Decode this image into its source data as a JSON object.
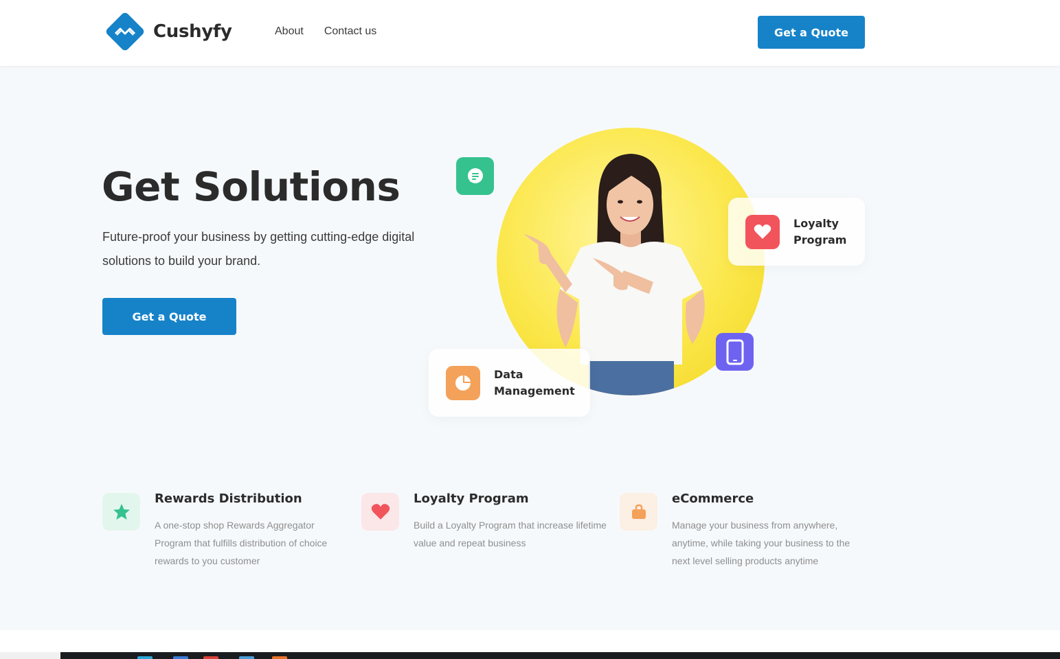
{
  "brand": {
    "name": "Cushyfy",
    "color": "#1683c9"
  },
  "nav": {
    "items": [
      "About",
      "Contact us"
    ]
  },
  "header": {
    "cta_label": "Get a Quote"
  },
  "hero": {
    "title": "Get Solutions",
    "subtitle": "Future-proof your business by getting cutting-edge digital solutions to build your brand.",
    "cta_label": "Get a Quote",
    "image": "smiling-woman-pointing",
    "floating_icons": [
      {
        "icon": "chat-icon",
        "color": "#35c28f"
      },
      {
        "icon": "phone-icon",
        "color": "#6e63f0"
      }
    ],
    "cards": [
      {
        "label_line1": "Loyalty",
        "label_line2": "Program",
        "icon": "heart-icon",
        "color": "#f2545b"
      },
      {
        "label_line1": "Data",
        "label_line2": "Management",
        "icon": "pie-chart-icon",
        "color": "#f4a15a"
      }
    ]
  },
  "features": [
    {
      "title": "Rewards Distribution",
      "description": "A one-stop shop Rewards Aggregator Program that fulfills distribution of choice rewards to you customer",
      "icon": "star-icon",
      "color": "#35c28f",
      "bg": "#e3f6ee"
    },
    {
      "title": "Loyalty Program",
      "description": "Build a Loyalty Program that increase lifetime value and repeat business",
      "icon": "heart-icon",
      "color": "#f2545b",
      "bg": "#fbe6e8"
    },
    {
      "title": "eCommerce",
      "description": "Manage your business from anywhere, anytime, while taking your business to the next level selling products anytime",
      "icon": "shopping-bag-icon",
      "color": "#f4a15a",
      "bg": "#fcefe3"
    }
  ]
}
